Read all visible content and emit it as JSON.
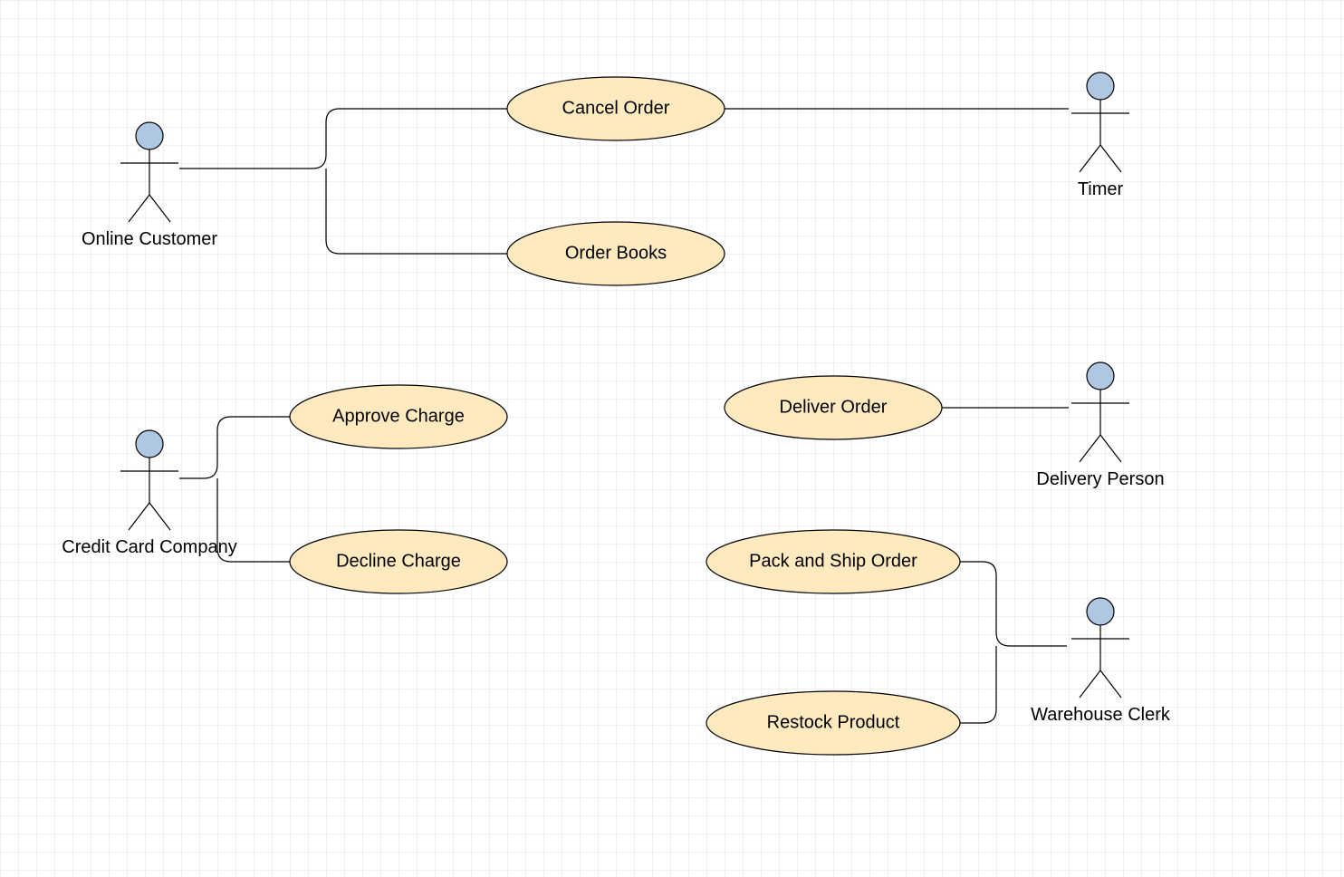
{
  "actors": {
    "online_customer": {
      "label": "Online Customer"
    },
    "timer": {
      "label": "Timer"
    },
    "credit_card_company": {
      "label": "Credit Card Company"
    },
    "delivery_person": {
      "label": "Delivery Person"
    },
    "warehouse_clerk": {
      "label": "Warehouse Clerk"
    }
  },
  "usecases": {
    "cancel_order": {
      "label": "Cancel Order"
    },
    "order_books": {
      "label": "Order Books"
    },
    "approve_charge": {
      "label": "Approve Charge"
    },
    "decline_charge": {
      "label": "Decline Charge"
    },
    "deliver_order": {
      "label": "Deliver Order"
    },
    "pack_and_ship_order": {
      "label": "Pack and Ship Order"
    },
    "restock_product": {
      "label": "Restock Product"
    }
  },
  "associations": [
    {
      "actor": "online_customer",
      "usecase": "cancel_order"
    },
    {
      "actor": "online_customer",
      "usecase": "order_books"
    },
    {
      "actor": "timer",
      "usecase": "cancel_order"
    },
    {
      "actor": "credit_card_company",
      "usecase": "approve_charge"
    },
    {
      "actor": "credit_card_company",
      "usecase": "decline_charge"
    },
    {
      "actor": "delivery_person",
      "usecase": "deliver_order"
    },
    {
      "actor": "warehouse_clerk",
      "usecase": "pack_and_ship_order"
    },
    {
      "actor": "warehouse_clerk",
      "usecase": "restock_product"
    }
  ]
}
